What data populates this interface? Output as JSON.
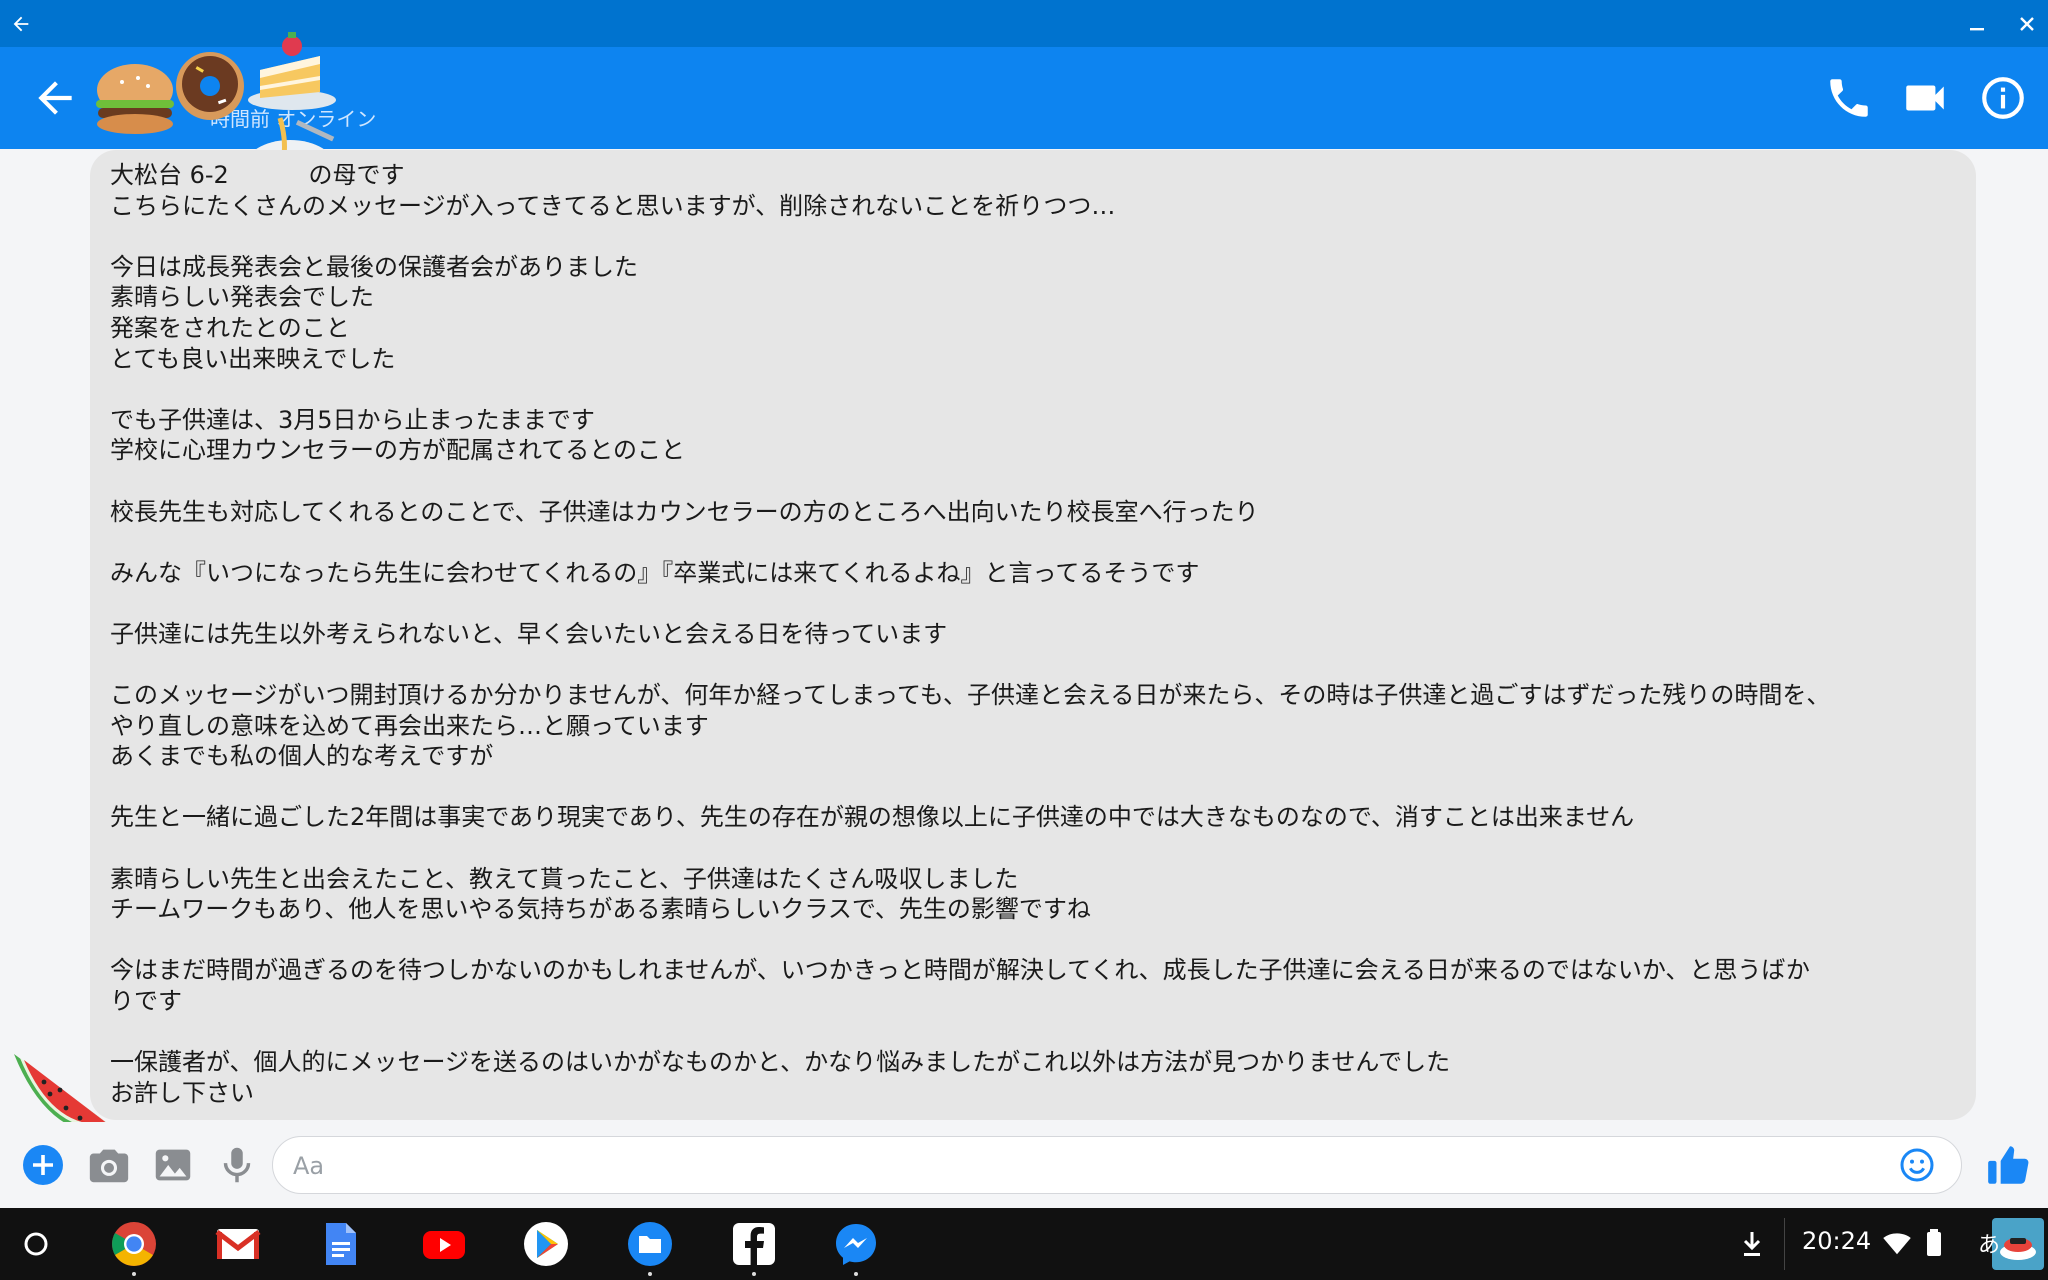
{
  "conversation": {
    "status": "時間前 オンライン"
  },
  "message": {
    "text": "大松台 6-2 　　　の母です\nこちらにたくさんのメッセージが入ってきてると思いますが、削除されないことを祈りつつ…\n\n今日は成長発表会と最後の保護者会がありました\n素晴らしい発表会でした\n発案をされたとのこと\nとても良い出来映えでした\n\nでも子供達は、3月5日から止まったままです\n学校に心理カウンセラーの方が配属されてるとのこと\n\n校長先生も対応してくれるとのことで、子供達はカウンセラーの方のところへ出向いたり校長室へ行ったり\n\nみんな『いつになったら先生に会わせてくれるの』『卒業式には来てくれるよね』と言ってるそうです\n\n子供達には先生以外考えられないと、早く会いたいと会える日を待っています\n\nこのメッセージがいつ開封頂けるか分かりませんが、何年か経ってしまっても、子供達と会える日が来たら、その時は子供達と過ごすはずだった残りの時間を、\nやり直しの意味を込めて再会出来たら…と願っています\nあくまでも私の個人的な考えですが\n\n先生と一緒に過ごした2年間は事実であり現実であり、先生の存在が親の想像以上に子供達の中では大きなものなので、消すことは出来ません\n\n素晴らしい先生と出会えたこと、教えて貰ったこと、子供達はたくさん吸収しました\nチームワークもあり、他人を思いやる気持ちがある素晴らしいクラスで、先生の影響ですね\n\n今はまだ時間が過ぎるのを待つしかないのかもしれませんが、いつかきっと時間が解決してくれ、成長した子供達に会える日が来るのではないか、と思うばか\nりです\n\n一保護者が、個人的にメッセージを送るのはいかがなものかと、かなり悩みましたがこれ以外は方法が見つかりませんでした\nお許し下さい"
  },
  "composer": {
    "placeholder": "Aa"
  },
  "system_tray": {
    "clock": "20:24",
    "ime": "あ"
  },
  "colors": {
    "titlebar": "#0073cf",
    "appbar": "#0d84f0",
    "bubble": "#e6e6e6",
    "accent": "#1a87f5",
    "shelf": "#111111"
  }
}
